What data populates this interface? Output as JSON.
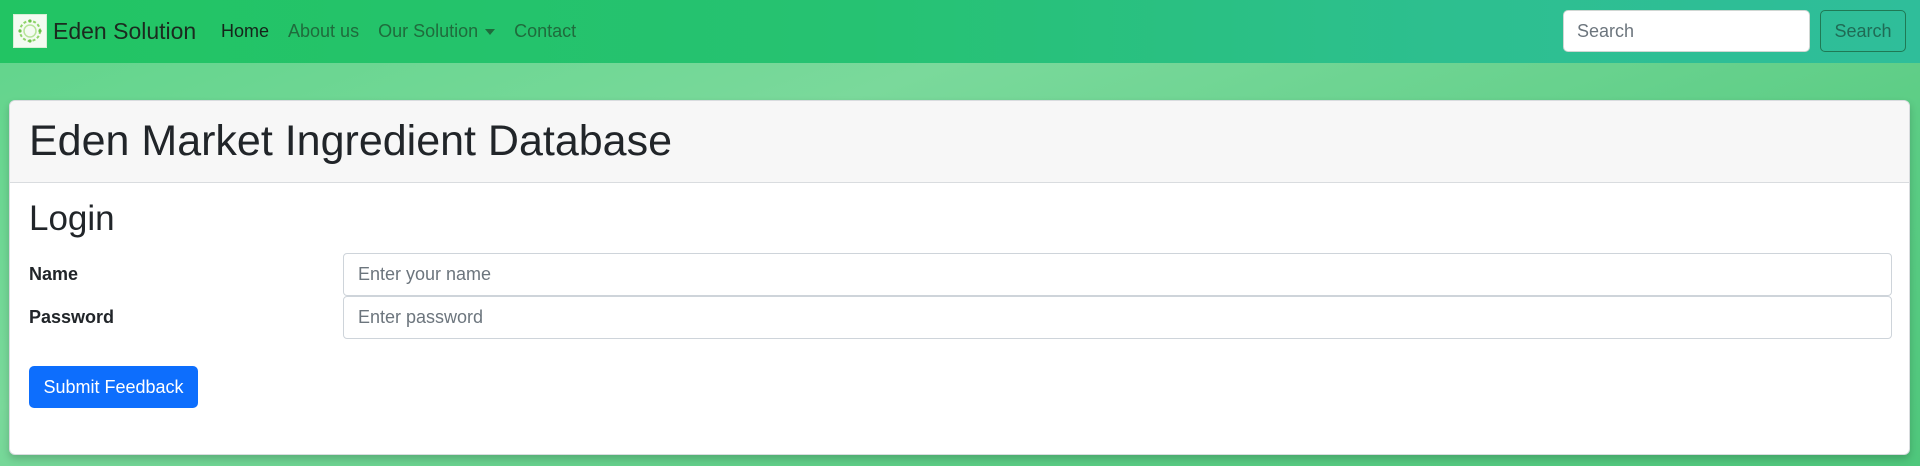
{
  "navbar": {
    "brand": "Eden Solution",
    "brand_logo_icon": "leaf-wreath-logo",
    "links": [
      {
        "label": "Home",
        "active": true
      },
      {
        "label": "About us",
        "active": false
      },
      {
        "label": "Our Solution",
        "active": false,
        "dropdown": true
      },
      {
        "label": "Contact",
        "active": false
      }
    ],
    "search": {
      "placeholder": "Search",
      "button_label": "Search"
    }
  },
  "card": {
    "header_title": "Eden Market Ingredient Database",
    "section_title": "Login",
    "fields": {
      "name": {
        "label": "Name",
        "placeholder": "Enter your name",
        "value": ""
      },
      "password": {
        "label": "Password",
        "placeholder": "Enter password",
        "value": ""
      }
    },
    "submit_label": "Submit Feedback"
  },
  "colors": {
    "navbar_start": "#22c463",
    "navbar_end": "#2fbe9a",
    "primary_button": "#0d6efd",
    "background": "#6ad592"
  }
}
